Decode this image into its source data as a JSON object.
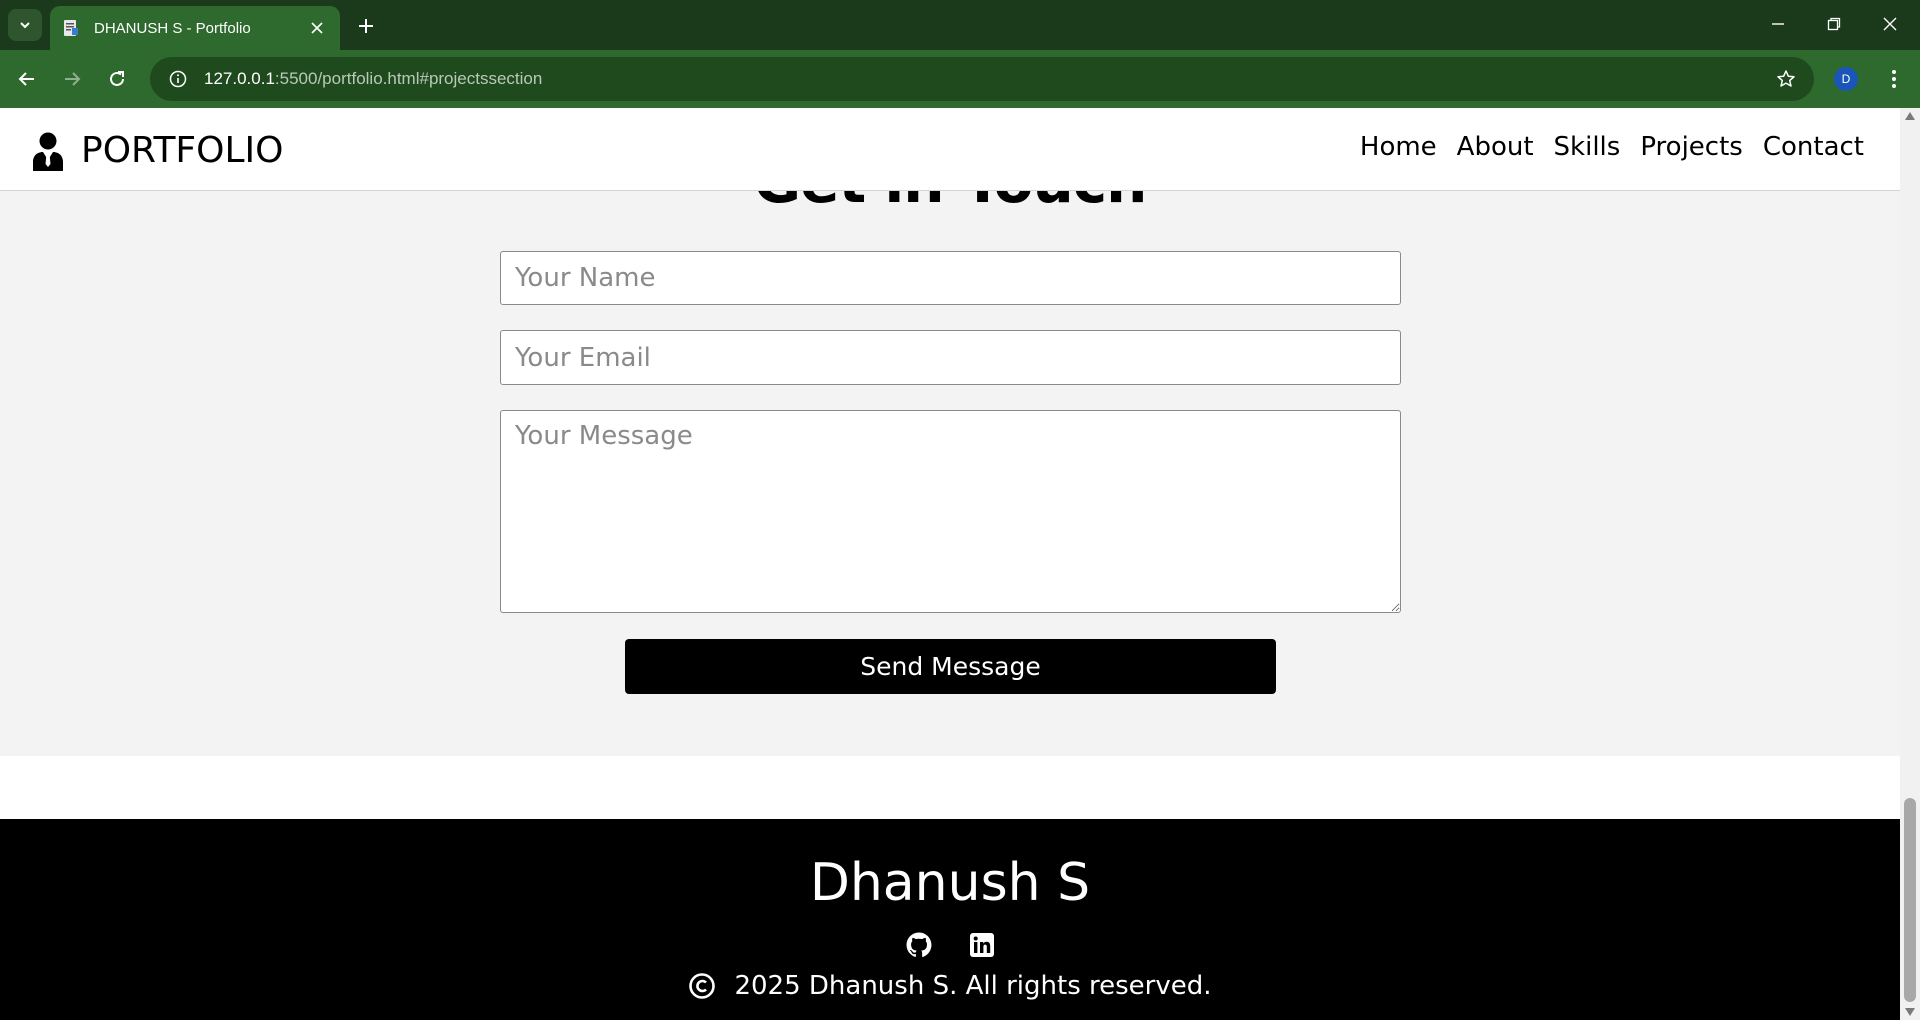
{
  "browser": {
    "tab_title": "DHANUSH S - Portfolio",
    "url_host": "127.0.0.1",
    "url_rest": ":5500/portfolio.html#projectssection",
    "profile_initial": "D"
  },
  "header": {
    "logo_text": "PORTFOLIO",
    "nav": [
      "Home",
      "About",
      "Skills",
      "Projects",
      "Contact"
    ]
  },
  "contact": {
    "heading": "Get in Touch",
    "name_placeholder": "Your Name",
    "email_placeholder": "Your Email",
    "message_placeholder": "Your Message",
    "send_label": "Send Message"
  },
  "footer": {
    "name": "Dhanush S",
    "copyright": "2025 Dhanush S. All rights reserved.",
    "social_icons": [
      "github-icon",
      "linkedin-icon"
    ]
  },
  "colors": {
    "browser_frame": "#1b3a1b",
    "browser_toolbar": "#2e6a2e",
    "section_bg": "#f3f3f3",
    "footer_bg": "#000000",
    "button_bg": "#000000"
  }
}
